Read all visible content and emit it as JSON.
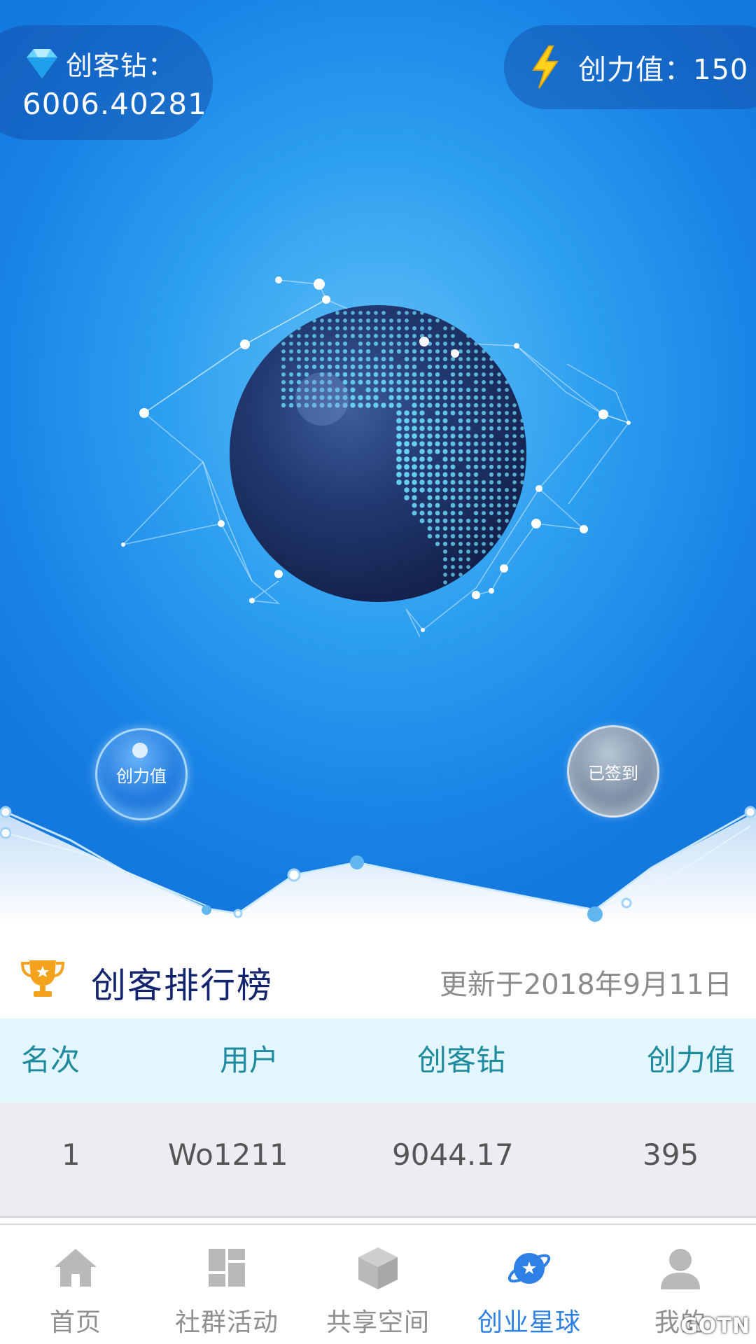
{
  "header": {
    "diamond_label": "创客钻：",
    "diamond_value": "6006.40281",
    "energy_text": "创力值：150",
    "diamond_icon": "diamond-icon",
    "energy_icon": "lightning-icon"
  },
  "hero": {
    "energy_bubble_label": "创力值",
    "signin_bubble_label": "已签到",
    "globe_icon": "globe-icon"
  },
  "leaderboard": {
    "title": "创客排行榜",
    "updated": "更新于2018年9月11日",
    "columns": [
      "名次",
      "用户",
      "创客钻",
      "创力值"
    ],
    "rows": [
      {
        "rank": "1",
        "user": "Wo1211",
        "diamonds": "9044.17",
        "energy": "395"
      }
    ]
  },
  "nav": {
    "items": [
      {
        "label": "首页",
        "icon": "home-icon"
      },
      {
        "label": "社群活动",
        "icon": "grid-icon"
      },
      {
        "label": "共享空间",
        "icon": "cube-icon"
      },
      {
        "label": "创业星球",
        "icon": "planet-icon",
        "active": true
      },
      {
        "label": "我的",
        "icon": "user-icon"
      }
    ]
  },
  "watermark": "GOTN",
  "colors": {
    "accent": "#2f80e4",
    "title": "#13256e",
    "column_header": "#1d8a9e",
    "hero_blue": "#1884e6"
  }
}
